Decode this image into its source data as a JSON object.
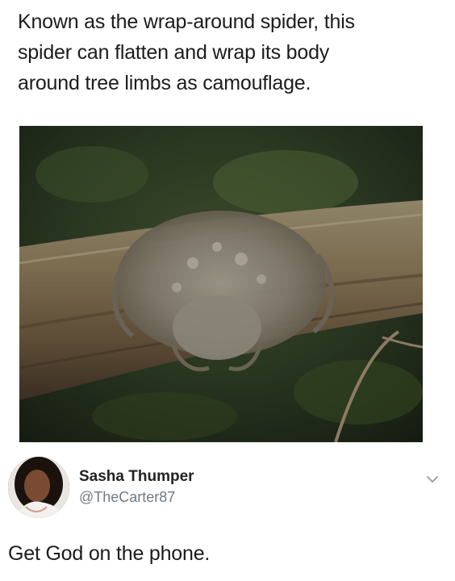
{
  "meme": {
    "caption_lines": [
      "Known as the wrap-around spider, this",
      "spider can flatten and wrap its body",
      "around tree limbs as camouflage."
    ]
  },
  "photo": {
    "description_icon": "spider-on-branch-photo"
  },
  "tweet": {
    "author_name": "Sasha Thumper",
    "author_handle": "@TheCarter87",
    "text": "Get God on the phone.",
    "menu_icon": "chevron-down-icon"
  },
  "colors": {
    "text": "#1c1c1c",
    "handle": "#6e7a86",
    "chevron": "#9aa4ae"
  }
}
